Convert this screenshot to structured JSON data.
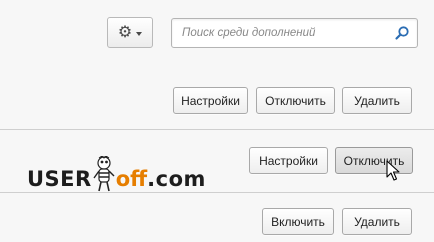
{
  "toolbar": {
    "gear_icon": "gear-icon",
    "search_placeholder": "Поиск среди дополнений",
    "search_value": ""
  },
  "addons": [
    {
      "buttons": {
        "settings": "Настройки",
        "disable": "Отключить",
        "remove": "Удалить"
      }
    },
    {
      "logo": {
        "part1": "USER",
        "part2": "off",
        "part3": ".com"
      },
      "buttons": {
        "settings": "Настройки",
        "disable": "Отключить"
      }
    },
    {
      "buttons": {
        "enable": "Включить",
        "remove": "Удалить"
      }
    }
  ],
  "colors": {
    "accent_orange": "#e67e00",
    "background": "#f7f7f7",
    "divider": "#cfcfcf"
  }
}
